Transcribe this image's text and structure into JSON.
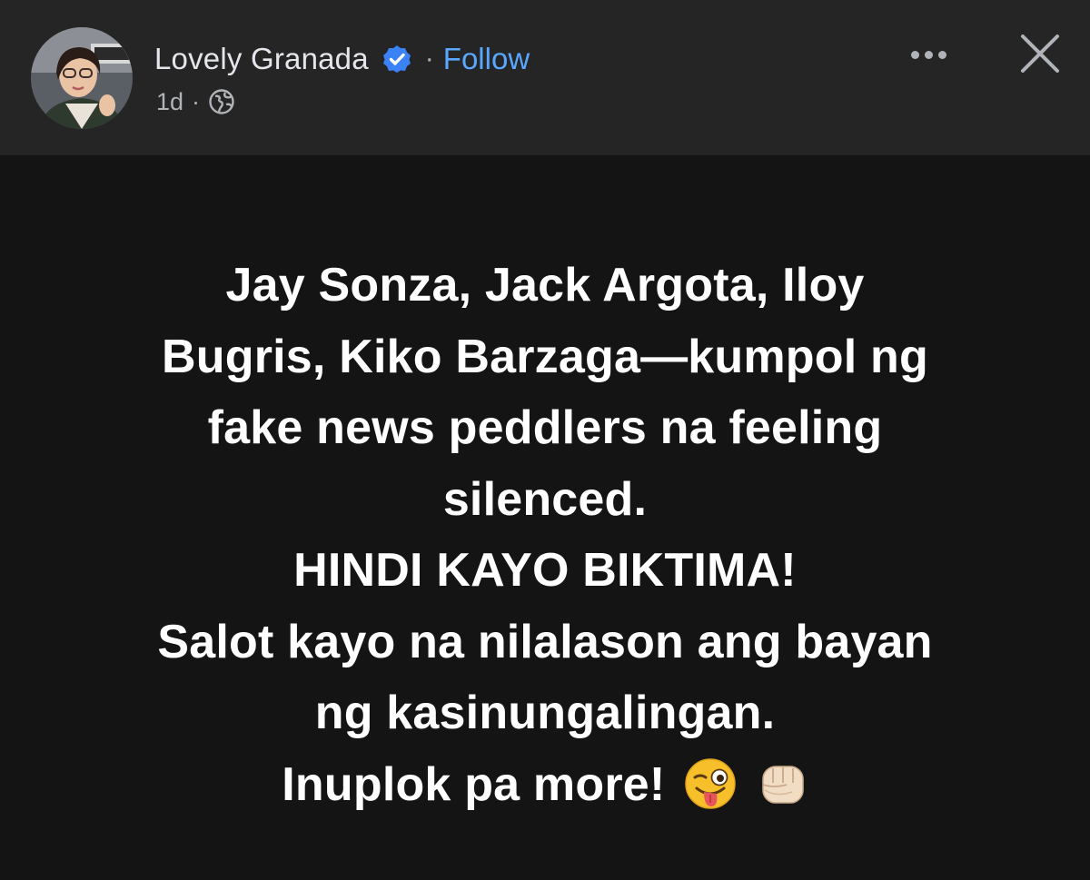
{
  "author": {
    "name": "Lovely Granada",
    "verified": true,
    "follow_label": "Follow",
    "separator": "·"
  },
  "meta": {
    "time": "1d",
    "separator": "·",
    "audience_icon": "globe-icon"
  },
  "actions": {
    "more_icon": "more-options-icon",
    "close_icon": "close-icon"
  },
  "post": {
    "lines": [
      "Jay Sonza, Jack Argota, Iloy",
      "Bugris, Kiko Barzaga—kumpol ng",
      "fake news peddlers na feeling",
      "silenced.",
      "HINDI KAYO BIKTIMA!",
      "Salot kayo na nilalason ang bayan",
      "ng kasinungalingan.",
      "Inuplok pa more!"
    ],
    "emojis": [
      "winking-face-with-tongue-emoji",
      "oncoming-fist-emoji"
    ]
  },
  "colors": {
    "header_bg": "#252526",
    "content_bg": "#141414",
    "link_blue": "#5aa7ff",
    "verified_blue": "#3b82f6",
    "text_white": "#ffffff",
    "muted": "#b0b3b8"
  }
}
